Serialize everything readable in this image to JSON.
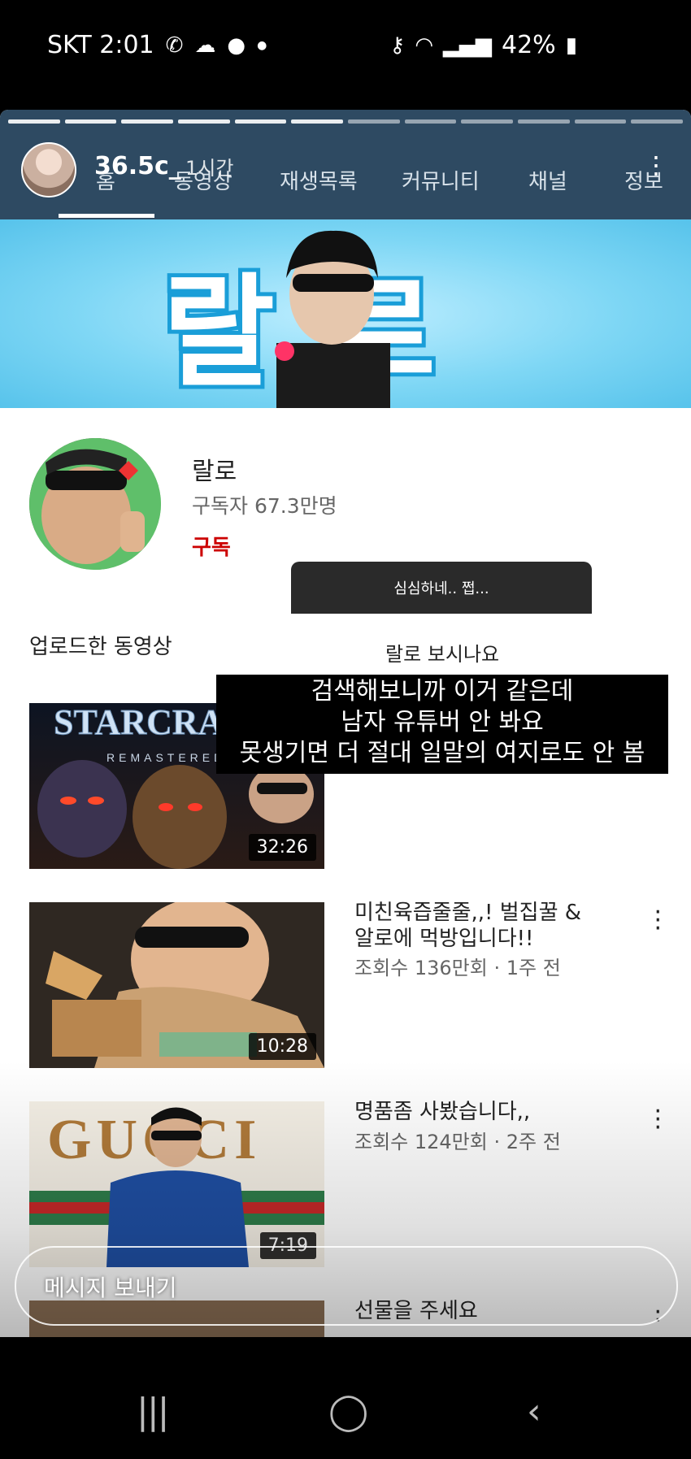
{
  "status_bar": {
    "carrier_time": "SKT 2:01",
    "battery": "42%",
    "icons_left": [
      "missed-call-icon",
      "weather-icon",
      "chat-icon",
      "dot-icon"
    ],
    "icons_right": [
      "key-icon",
      "wifi-icon",
      "signal-icon",
      "battery-icon"
    ]
  },
  "story": {
    "username": "36.5c_",
    "time_ago": "1시간",
    "reply_placeholder": "메시지 보내기"
  },
  "channel_tabs": [
    "홈",
    "동영상",
    "재생목록",
    "커뮤니티",
    "채널",
    "정보"
  ],
  "channel": {
    "banner_text": "랄로",
    "name": "랄로",
    "subscribers": "구독자 67.3만명",
    "subscribe_label": "구독"
  },
  "section_title": "업로드한 동영상",
  "videos": [
    {
      "thumb_text": "STARCRAFT",
      "thumb_sub": "REMASTERED",
      "duration": "32:26",
      "title": "",
      "meta": ""
    },
    {
      "thumb_text": "",
      "duration": "10:28",
      "title": "미친육즙줄줄,,! 벌집꿀 & 알로에 먹방입니다!!",
      "meta": "조회수 136만회 · 1주 전"
    },
    {
      "thumb_text": "GUCCI",
      "duration": "7:19",
      "title": "명품좀 사봤습니다,,",
      "meta": "조회수 124만회 · 2주 전"
    },
    {
      "thumb_text": "",
      "duration": "",
      "title": "선물을 주세요",
      "meta": ""
    }
  ],
  "overlay": {
    "message_box": "심심하네.. 쩝...",
    "question": "랄로 보시나요",
    "answer_lines": [
      "검색해보니까 이거 같은데",
      "남자 유튜버 안 봐요",
      "못생기면 더 절대 일말의 여지로도 안 봄"
    ]
  },
  "colors": {
    "header_bg": "#2e4a62",
    "subscribe_red": "#cc0000",
    "banner_blue": "#7fd7f5"
  }
}
